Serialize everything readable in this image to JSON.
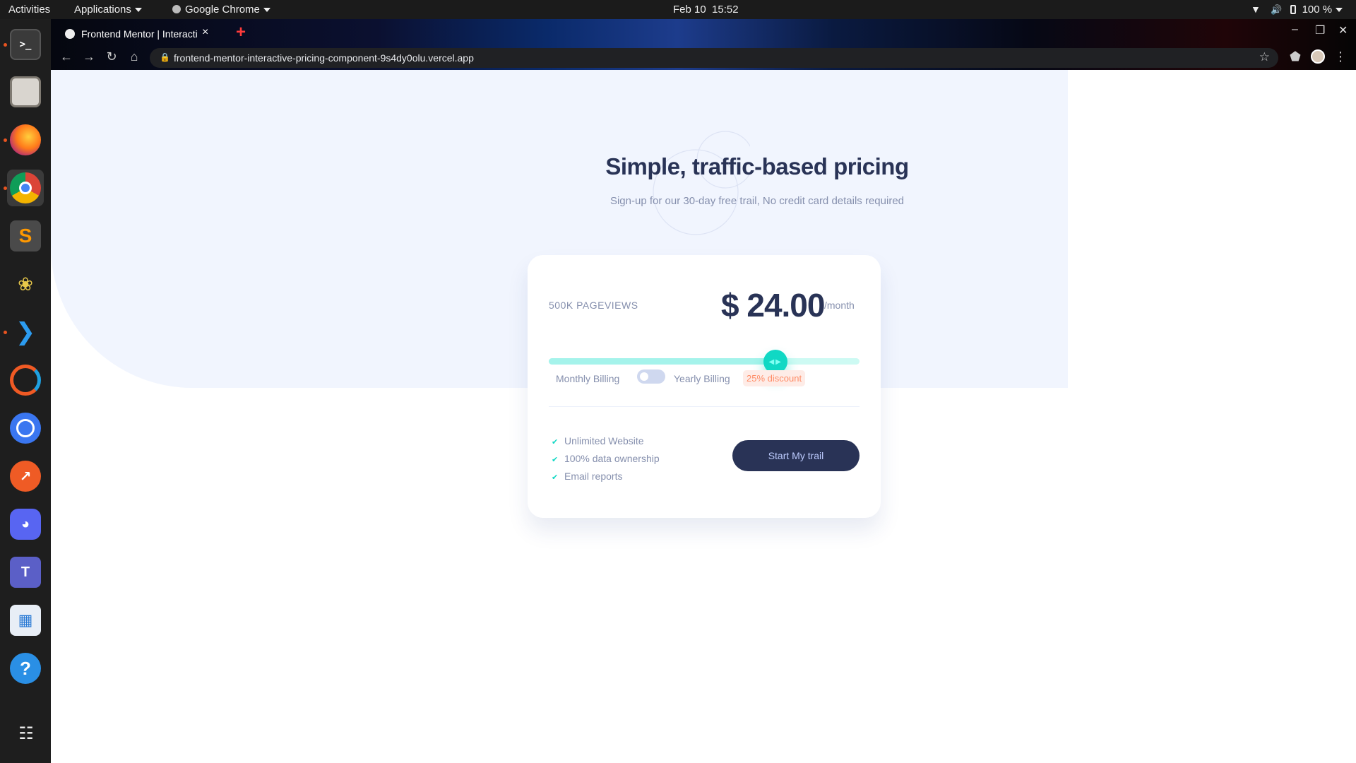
{
  "topbar": {
    "activities": "Activities",
    "applications": "Applications",
    "app_name": "Google Chrome",
    "date": "Feb 10",
    "time": "15:52",
    "battery": "100 %",
    "icons": [
      "wifi-icon",
      "volume-icon",
      "battery-icon",
      "system-menu-caret"
    ]
  },
  "dock": {
    "apps": [
      {
        "name": "terminal",
        "running": true
      },
      {
        "name": "files",
        "running": false
      },
      {
        "name": "firefox",
        "running": true
      },
      {
        "name": "chrome",
        "running": true,
        "active": true
      },
      {
        "name": "sublime-text",
        "running": false
      },
      {
        "name": "gitkraken",
        "running": false
      },
      {
        "name": "vscode",
        "running": true
      },
      {
        "name": "screencast",
        "running": false
      },
      {
        "name": "signal",
        "running": false
      },
      {
        "name": "postman",
        "running": false
      },
      {
        "name": "discord",
        "running": false
      },
      {
        "name": "teams",
        "running": false
      },
      {
        "name": "software-center",
        "running": false
      },
      {
        "name": "help",
        "running": false
      },
      {
        "name": "show-apps",
        "running": false
      }
    ],
    "accent_color": "#e95420"
  },
  "browser": {
    "tab_title": "Frontend Mentor | Interactive pricing component",
    "tab_close": "×",
    "new_tab": "+",
    "url": "frontend-mentor-interactive-pricing-component-9s4dy0olu.vercel.app",
    "window_controls": [
      "minimize",
      "maximize",
      "close"
    ]
  },
  "page": {
    "heading": "Simple, traffic-based pricing",
    "subheading": "Sign-up for our 30-day free trail, No credit card details required",
    "card": {
      "pageviews": "500K PAGEVIEWS",
      "price": "$ 24.00",
      "period": "/month",
      "slider_fraction": 0.73,
      "billing_monthly": "Monthly Billing",
      "billing_yearly": "Yearly Billing",
      "billing_yearly_on": false,
      "discount": "25% discount",
      "features": [
        "Unlimited Website",
        "100% data ownership",
        "Email reports"
      ],
      "cta": "Start My trail"
    },
    "colors": {
      "heading": "#293356",
      "muted": "#858fad",
      "accent": "#10d8c4",
      "slider_fill": "#a5f3eb",
      "slider_empty": "#cdfaf3",
      "discount_bg": "#feece7",
      "discount_text": "#ff8c66",
      "cta_bg": "#293356",
      "background": "#f1f5fe"
    }
  }
}
